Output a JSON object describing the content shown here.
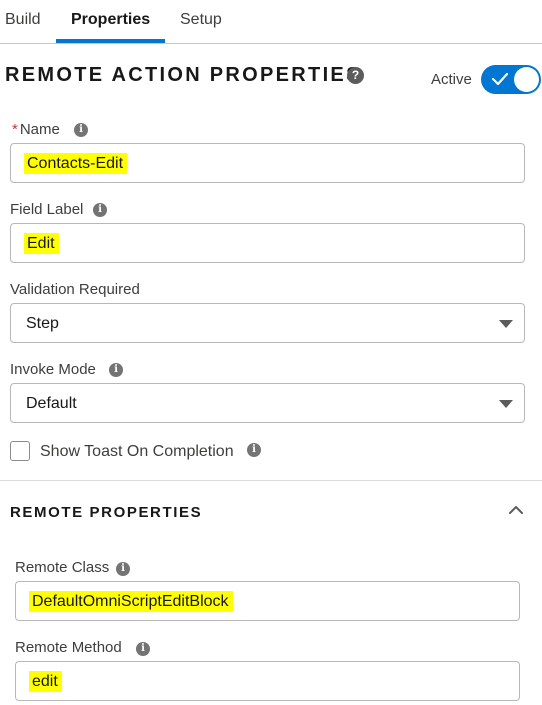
{
  "tabs": [
    {
      "label": "Build"
    },
    {
      "label": "Properties",
      "active": true
    },
    {
      "label": "Setup"
    }
  ],
  "header": {
    "title": "REMOTE ACTION PROPERTIES",
    "help_glyph": "?",
    "active_label": "Active",
    "active_on": true
  },
  "info_glyph": "i",
  "fields": {
    "name": {
      "required_mark": "*",
      "label": "Name",
      "value": "Contacts-Edit"
    },
    "field_label": {
      "label": "Field Label",
      "value": "Edit"
    },
    "validation_required": {
      "label": "Validation Required",
      "value": "Step"
    },
    "invoke_mode": {
      "label": "Invoke Mode",
      "value": "Default"
    },
    "show_toast": {
      "label": "Show Toast On Completion",
      "checked": false
    }
  },
  "remote_properties": {
    "title": "REMOTE PROPERTIES",
    "expanded": true,
    "remote_class": {
      "label": "Remote Class",
      "value": "DefaultOmniScriptEditBlock"
    },
    "remote_method": {
      "label": "Remote Method",
      "value": "edit"
    }
  },
  "colors": {
    "accent": "#0176d3",
    "highlight": "#ffff00",
    "required": "#c23934"
  },
  "icons": {
    "help": "help-icon",
    "info": "info-icon",
    "toggle_check": "check-icon",
    "dropdown": "chevron-down-icon",
    "collapse": "chevron-up-icon"
  }
}
